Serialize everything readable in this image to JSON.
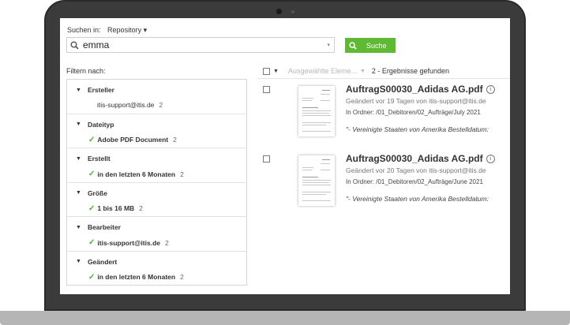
{
  "search": {
    "label": "Suchen in:",
    "scope": "Repository ▾",
    "value": "emma",
    "button_label": "Suche"
  },
  "filters": {
    "title": "Filtern nach:",
    "groups": [
      {
        "name": "Ersteller",
        "item": "itis-support@itis.de",
        "count": "2",
        "selected": false
      },
      {
        "name": "Dateityp",
        "item": "Adobe PDF Document",
        "count": "2",
        "selected": true
      },
      {
        "name": "Erstellt",
        "item": "in den letzten 6 Monaten",
        "count": "2",
        "selected": true
      },
      {
        "name": "Größe",
        "item": "1 bis 16 MB",
        "count": "2",
        "selected": true
      },
      {
        "name": "Bearbeiter",
        "item": "itis-support@itis.de",
        "count": "2",
        "selected": true
      },
      {
        "name": "Geändert",
        "item": "in den letzten 6 Monaten",
        "count": "2",
        "selected": true
      }
    ]
  },
  "results": {
    "selected_items_label": "Ausgewählte Eleme...",
    "count_text": "2 - Ergebnisse gefunden",
    "items": [
      {
        "title": "AuftragS00030_Adidas AG.pdf",
        "meta": "Geändert vor 19 Tagen von itis-support@itis.de",
        "folder": "In Ordner: /01_Debitoren/02_Aufträge/July 2021",
        "snippet": "\"- Vereinigte Staaten von Amerika Bestelldatum:"
      },
      {
        "title": "AuftragS00030_Adidas AG.pdf",
        "meta": "Geändert vor 20 Tagen von itis-support@itis.de",
        "folder": "In Ordner: /01_Debitoren/02_Aufträge/June 2021",
        "snippet": "\"- Vereinigte Staaten von Amerika Bestelldatum:"
      }
    ]
  },
  "icons": {
    "info": "i",
    "check": "✓",
    "triangle": "▼",
    "dropdown": "▾"
  },
  "colors": {
    "accent_green": "#5fb933",
    "check_green": "#4caf2f",
    "bezel": "#3b3b3b"
  }
}
